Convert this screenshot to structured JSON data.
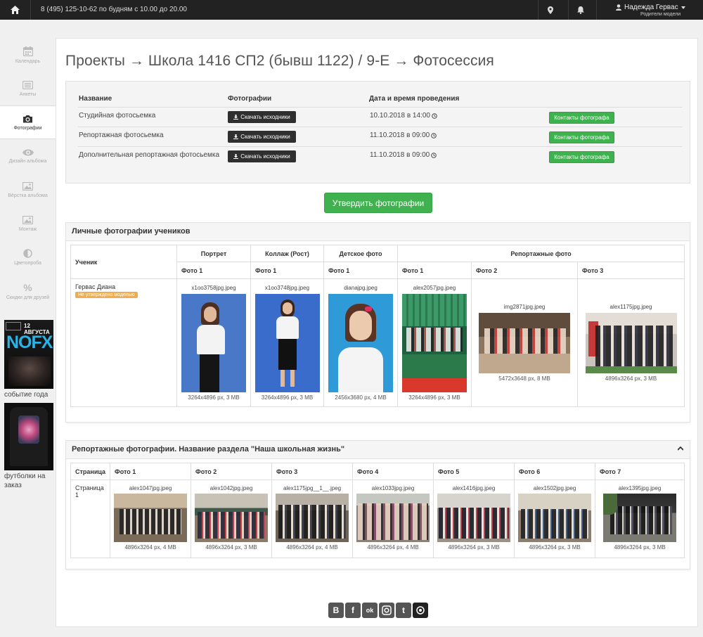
{
  "topbar": {
    "phone": "8 (495) 125-10-62 по будням с 10.00 до 20.00",
    "user_name": "Надежда Гервас",
    "user_role": "Родители модели"
  },
  "sidebar": {
    "items": [
      {
        "label": "Календарь",
        "icon": "calendar-icon"
      },
      {
        "label": "Анкеты",
        "icon": "list-icon"
      },
      {
        "label": "Фотографии",
        "icon": "camera-icon"
      },
      {
        "label": "Дизайн альбома",
        "icon": "eye-icon"
      },
      {
        "label": "Вёрстка альбома",
        "icon": "picture-icon"
      },
      {
        "label": "Монтаж",
        "icon": "picture-icon"
      },
      {
        "label": "Цветопроба",
        "icon": "half-circle-icon"
      },
      {
        "label": "Скидки для друзей",
        "icon": "percent-icon"
      }
    ],
    "promos": [
      {
        "caption": "событие года",
        "poster_title": "NOFX",
        "poster_date": "12 АВГУСТА"
      },
      {
        "caption": "футболки на заказ"
      }
    ]
  },
  "title": "Проекты → Школа 1416 СП2 (бывш 1122) / 9-Е → Фотосессия",
  "sessions": {
    "headers": {
      "name": "Название",
      "photos": "Фотографии",
      "date": "Дата и время проведения"
    },
    "download_label": "Скачать исходники",
    "contact_label": "Контакты фотографа",
    "rows": [
      {
        "name": "Студийная фотосьемка",
        "date": "10.10.2018 в 14:00"
      },
      {
        "name": "Репортажная фотосьемка",
        "date": "11.10.2018 в 09:00"
      },
      {
        "name": "Дополнительная репортажная фотосьемка",
        "date": "11.10.2018 в 09:00"
      }
    ]
  },
  "approve_label": "Утвердить фотографии",
  "personal": {
    "title": "Личные фотографии учеников",
    "col_student": "Ученик",
    "groups": [
      "Портрет",
      "Коллаж (Рост)",
      "Детское фото",
      "Репортажные фото"
    ],
    "subcols": [
      "Фото 1",
      "Фото 1",
      "Фото 1",
      "Фото 1",
      "Фото 2",
      "Фото 3"
    ],
    "student": {
      "name": "Гервас Диана",
      "status": "Не утверждено моделью"
    },
    "photos": [
      {
        "file": "x1oo3758jpg.jpeg",
        "size": "3264x4896 px, 3 MB"
      },
      {
        "file": "x1oo3748jpg.jpeg",
        "size": "3264x4896 px, 3 MB"
      },
      {
        "file": "dianajpg.jpeg",
        "size": "2456x3680 px, 4 MB"
      },
      {
        "file": "alex2057jpg.jpeg",
        "size": "3264x4896 px, 3 MB"
      },
      {
        "file": "img2871jpg.jpeg",
        "size": "5472x3648 px, 8 MB"
      },
      {
        "file": "alex1175jpg.jpeg",
        "size": "4896x3264 px, 3 MB"
      }
    ]
  },
  "reportage": {
    "title": "Репортажные фотографии. Название раздела \"Наша школьная жизнь\"",
    "col_page": "Страница",
    "cols": [
      "Фото 1",
      "Фото 2",
      "Фото 3",
      "Фото 4",
      "Фото 5",
      "Фото 6",
      "Фото 7"
    ],
    "page_label": "Страница 1",
    "photos": [
      {
        "file": "alex1047jpg.jpeg",
        "size": "4896x3264 px, 4 MB"
      },
      {
        "file": "alex1042jpg.jpeg",
        "size": "4896x3264 px, 3 MB"
      },
      {
        "file": "alex1175jpg__1__.jpeg",
        "size": "4896x3264 px, 4 MB"
      },
      {
        "file": "alex1033jpg.jpeg",
        "size": "4896x3264 px, 4 MB"
      },
      {
        "file": "alex1416jpg.jpeg",
        "size": "4896x3264 px, 3 MB"
      },
      {
        "file": "alex1502jpg.jpeg",
        "size": "4896x3264 px, 3 MB"
      },
      {
        "file": "alex1395jpg.jpeg",
        "size": "4896x3264 px, 3 MB"
      }
    ]
  },
  "social": [
    {
      "label": "В",
      "name": "vk-icon"
    },
    {
      "label": "f",
      "name": "facebook-icon"
    },
    {
      "label": "ok",
      "name": "odnoklassniki-icon"
    },
    {
      "label": "",
      "name": "instagram-icon"
    },
    {
      "label": "t",
      "name": "twitter-icon"
    },
    {
      "label": "",
      "name": "photo-service-icon"
    }
  ]
}
